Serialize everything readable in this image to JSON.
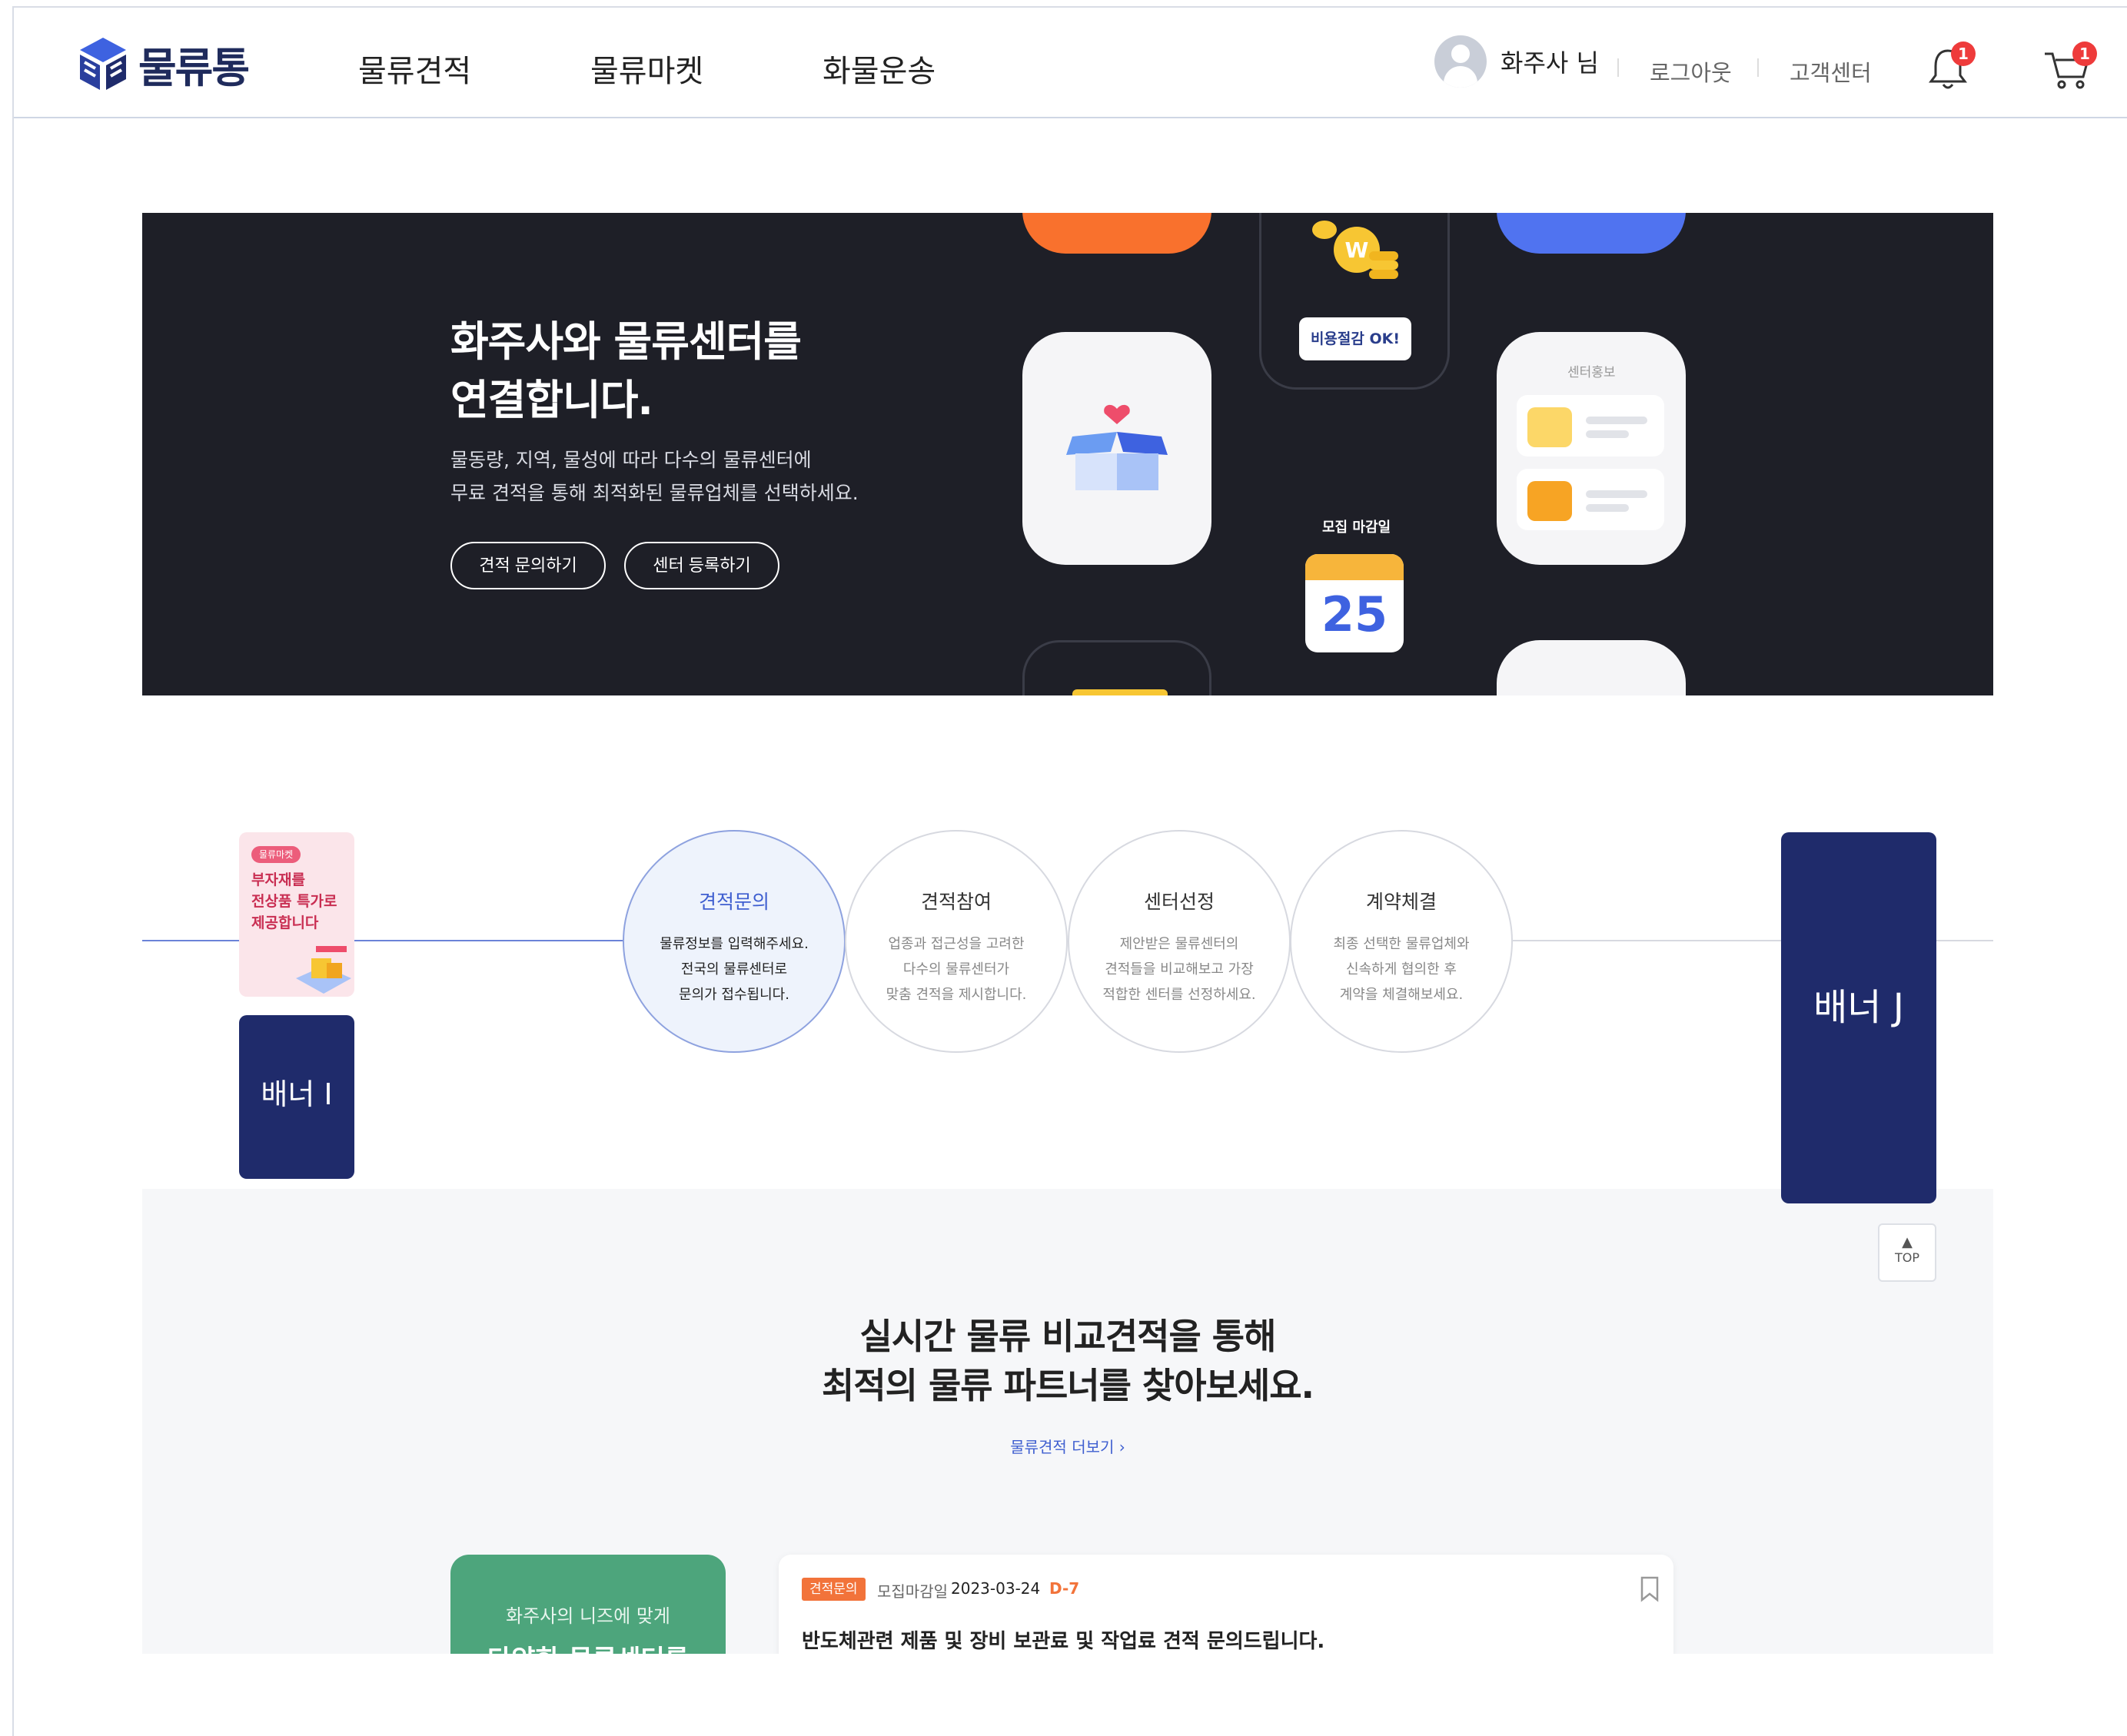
{
  "brand": {
    "name": "물류통"
  },
  "nav": {
    "items": [
      {
        "label": "물류견적"
      },
      {
        "label": "물류마켓"
      },
      {
        "label": "화물운송"
      }
    ]
  },
  "user": {
    "name": "화주사 님",
    "logout": "로그아웃",
    "support": "고객센터",
    "notification_count": "1",
    "cart_count": "1"
  },
  "hero": {
    "title": "화주사와 물류센터를\n연결합니다.",
    "subtitle": "물동량, 지역, 물성에 따라 다수의 물류센터에\n무료 견적을 통해 최적화된 물류업체를 선택하세요.",
    "btn_quote": "견적 문의하기",
    "btn_register": "센터 등록하기",
    "cost_label": "비용절감 OK!",
    "deadline_label": "모집 마감일",
    "calendar_day": "25",
    "center_card_title": "센터홍보"
  },
  "process": {
    "steps": [
      {
        "title": "견적문의",
        "desc": "물류정보를 입력해주세요.\n전국의 물류센터로\n문의가 접수됩니다."
      },
      {
        "title": "견적참여",
        "desc": "업종과 접근성을 고려한\n다수의 물류센터가\n맞춤 견적을 제시합니다."
      },
      {
        "title": "센터선정",
        "desc": "제안받은 물류센터의\n견적들을 비교해보고 가장\n적합한 센터를 선정하세요."
      },
      {
        "title": "계약체결",
        "desc": "최종 선택한 물류업체와\n신속하게 협의한 후\n계약을 체결해보세요."
      }
    ]
  },
  "side": {
    "promo_tag": "물류마켓",
    "promo_text": "부자재를\n전상품 특가로\n제공합니다",
    "banner_i": "배너 I",
    "banner_j": "배너 J"
  },
  "section": {
    "title": "실시간 물류 비교견적을 통해\n최적의 물류 파트너를 찾아보세요.",
    "more": "물류견적 더보기",
    "green_line1": "화주사의 니즈에 맞게",
    "green_line2": "다양한 물류센터를"
  },
  "quote": {
    "tag": "견적문의",
    "meta_label": "모집마감일",
    "date": "2023-03-24",
    "dday": "D-7",
    "title": "반도체관련 제품 및 장비 보관료 및 작업료 견적 문의드립니다."
  },
  "top_button": {
    "label": "TOP"
  },
  "colors": {
    "brand_navy": "#1f2b6b",
    "accent_blue": "#3f5fd0",
    "hero_bg": "#1e1f27",
    "orange": "#f2733a",
    "green": "#4da57c"
  }
}
